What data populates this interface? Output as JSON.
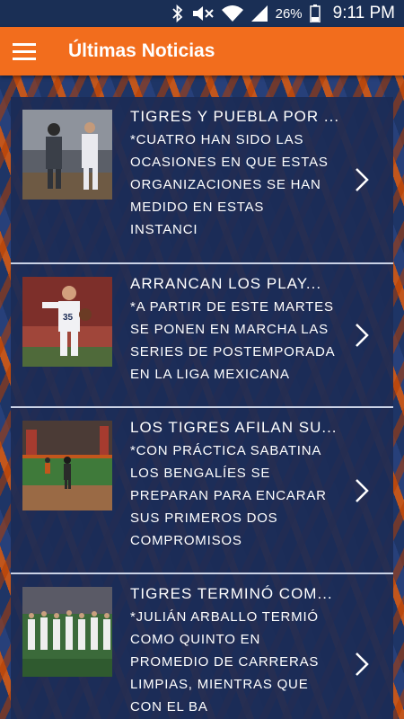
{
  "status_bar": {
    "icons": [
      "bluetooth-icon",
      "mute-icon",
      "wifi-icon",
      "signal-icon",
      "battery-icon"
    ],
    "battery": "26%",
    "time": "9:11 PM"
  },
  "app_bar": {
    "menu_icon": "hamburger-menu-icon",
    "title": "Últimas Noticias",
    "color": "#f26d1d"
  },
  "news": [
    {
      "title": "TIGRES Y PUEBLA POR ...",
      "summary": "*CUATRO HAN SIDO LAS\nOCASIONES EN QUE ESTAS\nORGANIZACIONES SE HAN\nMEDIDO EN ESTAS\nINSTANCI",
      "thumb_icon": "baseball-photo-thumbnail"
    },
    {
      "title": "ARRANCAN LOS PLAY...",
      "summary": "*A PARTIR DE ESTE MARTES\nSE PONEN EN MARCHA LAS\nSERIES DE POSTEMPORADA\nEN LA LIGA MEXICANA",
      "thumb_icon": "pitcher-photo-thumbnail"
    },
    {
      "title": "LOS TIGRES AFILAN SU...",
      "summary": "*CON PRÁCTICA SABATINA\nLOS BENGALÍES SE\nPREPARAN PARA ENCARAR\nSUS PRIMEROS DOS\nCOMPROMISOS",
      "thumb_icon": "practice-photo-thumbnail"
    },
    {
      "title": "TIGRES TERMINÓ COM...",
      "summary": "*JULIÁN ARBALLO TERMIÓ\nCOMO QUINTO EN\nPROMEDIO DE CARRERAS\nLIMPIAS, MIENTRAS QUE\nCON EL BA",
      "thumb_icon": "team-photo-thumbnail"
    }
  ]
}
